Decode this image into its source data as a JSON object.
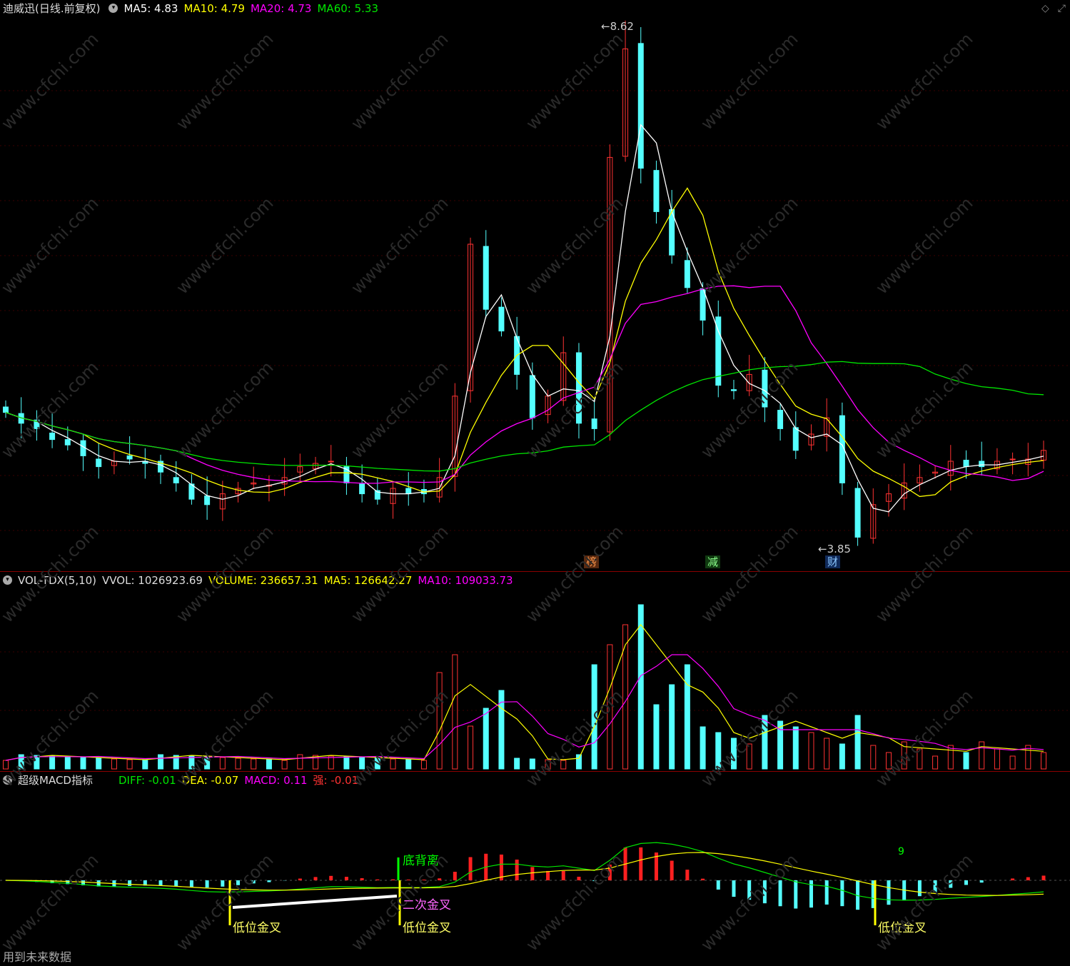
{
  "main": {
    "stock": "迪威迅(日线.前复权)",
    "ma5": "MA5: 4.83",
    "ma10": "MA10: 4.79",
    "ma20": "MA20: 4.73",
    "ma60": "MA60: 5.33",
    "high_label": "8.62",
    "low_label": "3.85",
    "badges": [
      "榜",
      "减",
      "财"
    ],
    "colors": {
      "up": "#ff3232",
      "down": "#54ffff",
      "ma5": "#ffffff",
      "ma10": "#ffff00",
      "ma20": "#ff00ff",
      "ma60": "#00e600"
    }
  },
  "volume": {
    "name": "VOL-TDX(5,10)",
    "vvol": "VVOL: 1026923.69",
    "volume": "VOLUME: 236657.31",
    "ma5": "MA5: 126642.27",
    "ma10": "MA10: 109033.73"
  },
  "macd": {
    "name": "超级MACD指标",
    "diff": "DIFF: -0.01",
    "dea": "DEA: -0.07",
    "macd": "MACD: 0.11",
    "strong": "强: -0.01",
    "labels": {
      "low_cross_1": "低位金叉",
      "low_cross_2": "低位金叉",
      "low_cross_3": "低位金叉",
      "second_cross": "二次金叉",
      "bottom_divergence": "底背离",
      "nine": "9"
    }
  },
  "watermark": "www.cfchi.com",
  "footer": "用到未来数据",
  "icons": [
    "diamond-icon",
    "maximize-icon"
  ],
  "chart_data": {
    "type": "candlestick",
    "price_range": [
      3.85,
      8.62
    ],
    "close_points": [
      5.05,
      4.95,
      4.9,
      4.8,
      4.75,
      4.65,
      4.55,
      4.6,
      4.62,
      4.58,
      4.5,
      4.4,
      4.25,
      4.2,
      4.3,
      4.35,
      4.4,
      4.38,
      4.45,
      4.55,
      4.58,
      4.6,
      4.4,
      4.3,
      4.25,
      4.35,
      4.3,
      4.3,
      4.45,
      5.2,
      6.6,
      6.0,
      5.8,
      5.4,
      5.0,
      5.2,
      5.6,
      4.95,
      4.9,
      7.4,
      8.4,
      7.3,
      6.9,
      6.5,
      6.2,
      5.9,
      5.3,
      5.25,
      5.4,
      5.1,
      4.9,
      4.7,
      4.85,
      5.0,
      4.4,
      3.9,
      4.2,
      4.3,
      4.4,
      4.45,
      4.5,
      4.6,
      4.55,
      4.55,
      4.6,
      4.62,
      4.62,
      4.7
    ]
  }
}
